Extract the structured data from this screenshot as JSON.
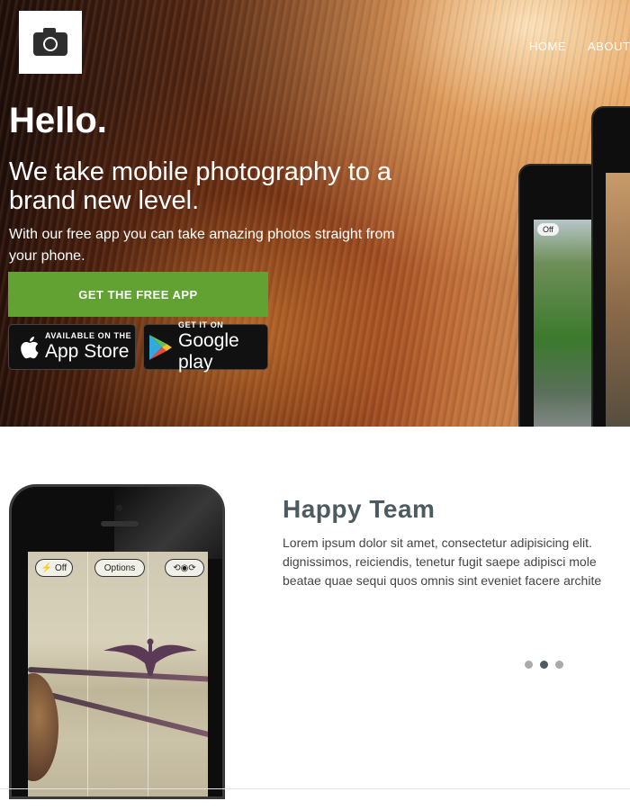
{
  "nav": {
    "items": [
      "HOME",
      "ABOUT"
    ]
  },
  "hero": {
    "title": "Hello.",
    "subtitle": "We take mobile photography to a brand new level.",
    "lead": "With our free app you can take amazing photos straight from your phone.",
    "cta": "GET THE FREE APP",
    "app_store": {
      "small": "AVAILABLE ON THE",
      "big": "App Store"
    },
    "google_play": {
      "small": "GET IT ON",
      "big": "Google play"
    },
    "phone_flash": "Off"
  },
  "feature": {
    "title": "Happy Team",
    "text_lines": [
      "Lorem ipsum dolor sit amet, consectetur adipisicing elit.",
      "dignissimos, reiciendis, tenetur fugit saepe adipisci mole",
      "beatae quae sequi quos omnis sint eveniet facere archite"
    ],
    "phone_buttons": {
      "flash": "Off",
      "options": "Options"
    }
  },
  "slider": {
    "count": 3,
    "active_index": 1
  },
  "colors": {
    "cta": "#62a233",
    "heading": "#4d5a60",
    "dot_active": "#4d5a60",
    "dot": "#a8abad"
  }
}
